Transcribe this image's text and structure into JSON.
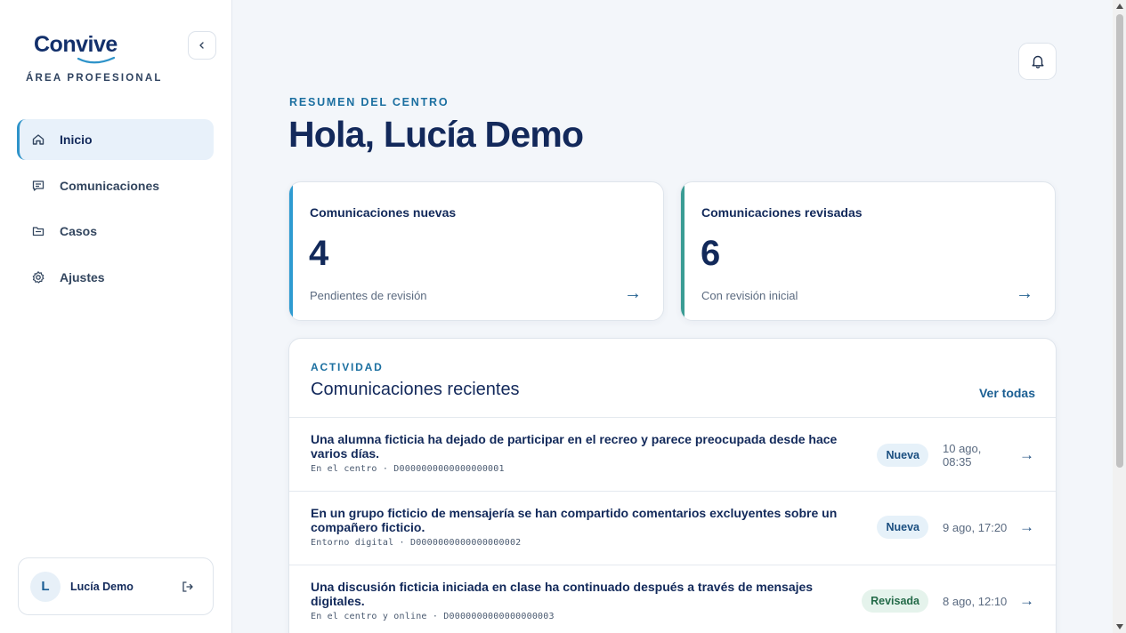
{
  "brand": {
    "logo_text": "Convive",
    "area_label": "ÁREA PROFESIONAL",
    "accent_color": "#2e93c9"
  },
  "sidebar": {
    "items": [
      {
        "label": "Inicio",
        "icon": "home-icon",
        "active": true
      },
      {
        "label": "Comunicaciones",
        "icon": "message-icon",
        "active": false
      },
      {
        "label": "Casos",
        "icon": "folder-icon",
        "active": false
      },
      {
        "label": "Ajustes",
        "icon": "settings-icon",
        "active": false
      }
    ],
    "user": {
      "initial": "L",
      "name": "Lucía Demo"
    }
  },
  "header": {
    "eyebrow": "RESUMEN DEL CENTRO",
    "greeting": "Hola, Lucía Demo"
  },
  "stats": [
    {
      "title": "Comunicaciones nuevas",
      "value": "4",
      "subtitle": "Pendientes de revisión",
      "arrow": "→",
      "color": "#2e9bd1"
    },
    {
      "title": "Comunicaciones revisadas",
      "value": "6",
      "subtitle": "Con revisión inicial",
      "arrow": "→",
      "color": "#3a9c94"
    }
  ],
  "activity": {
    "eyebrow": "ACTIVIDAD",
    "title": "Comunicaciones recientes",
    "see_all": "Ver todas",
    "rows": [
      {
        "title": "Una alumna ficticia ha dejado de participar en el recreo y parece preocupada desde hace varios días.",
        "meta": "En el centro · D0000000000000000001",
        "badge": "Nueva",
        "badge_type": "new",
        "date": "10 ago, 08:35",
        "arrow": "→"
      },
      {
        "title": "En un grupo ficticio de mensajería se han compartido comentarios excluyentes sobre un compañero ficticio.",
        "meta": "Entorno digital · D0000000000000000002",
        "badge": "Nueva",
        "badge_type": "new",
        "date": "9 ago, 17:20",
        "arrow": "→"
      },
      {
        "title": "Una discusión ficticia iniciada en clase ha continuado después a través de mensajes digitales.",
        "meta": "En el centro y online · D0000000000000000003",
        "badge": "Revisada",
        "badge_type": "rev",
        "date": "8 ago, 12:10",
        "arrow": "→"
      }
    ]
  }
}
